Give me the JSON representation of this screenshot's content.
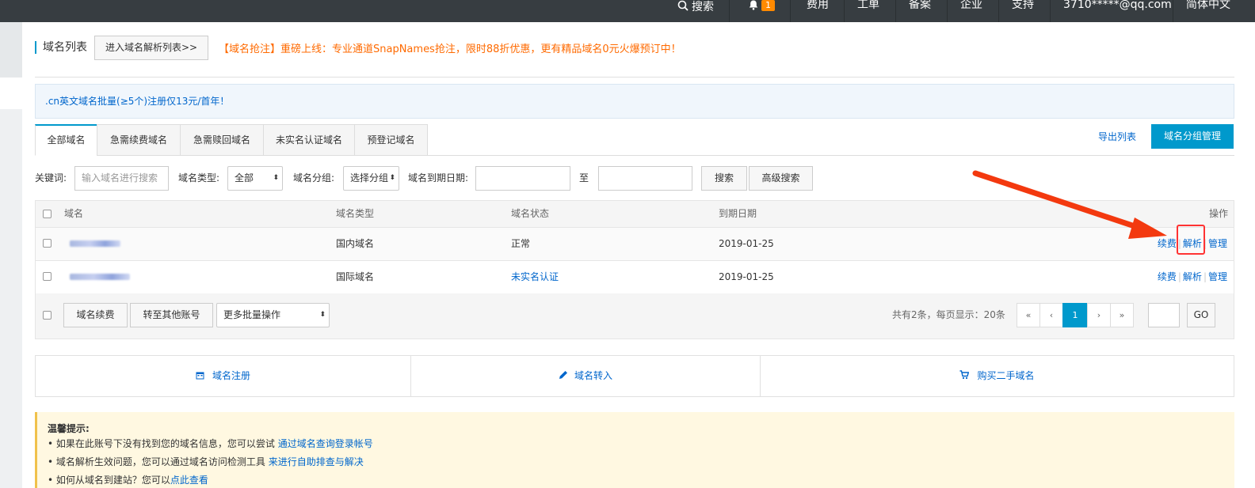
{
  "topbar": {
    "search": "搜索",
    "notice_count": "1",
    "fees": "费用",
    "tickets": "工单",
    "icp": "备案",
    "enterprise": "企业",
    "support": "支持",
    "account": "3710*****@qq.com",
    "language": "简体中文"
  },
  "header": {
    "title": "域名列表",
    "dns_list_button": "进入域名解析列表>>",
    "promo": "【域名抢注】重磅上线：专业通道SnapNames抢注，限时88折优惠，更有精品域名0元火爆预订中！"
  },
  "notice": ".cn英文域名批量(≥5个)注册仅13元/首年！",
  "tabs": [
    "全部域名",
    "急需续费域名",
    "急需赎回域名",
    "未实名认证域名",
    "预登记域名"
  ],
  "actions": {
    "export": "导出列表",
    "group_manage": "域名分组管理"
  },
  "filters": {
    "keyword_label": "关键词:",
    "keyword_placeholder": "输入域名进行搜索",
    "type_label": "域名类型:",
    "type_value": "全部",
    "group_label": "域名分组:",
    "group_value": "选择分组",
    "expire_label": "域名到期日期:",
    "to": "至",
    "search": "搜索",
    "advanced": "高级搜索"
  },
  "table": {
    "headers": {
      "domain": "域名",
      "type": "域名类型",
      "status": "域名状态",
      "expire": "到期日期",
      "ops": "操作"
    },
    "rows": [
      {
        "type": "国内域名",
        "status": "正常",
        "expire": "2019-01-25",
        "renew": "续费",
        "resolve": "解析",
        "manage": "管理"
      },
      {
        "type": "国际域名",
        "status": "未实名认证",
        "expire": "2019-01-25",
        "renew": "续费",
        "resolve": "解析",
        "manage": "管理"
      }
    ]
  },
  "bulk": {
    "renew": "域名续费",
    "transfer": "转至其他账号",
    "more": "更多批量操作",
    "summary": "共有2条，每页显示：20条",
    "first": "«",
    "prev": "‹",
    "page": "1",
    "next": "›",
    "last": "»",
    "go": "GO"
  },
  "quick": {
    "register": "域名注册",
    "transfer_in": "域名转入",
    "buy": "购买二手域名"
  },
  "tips": {
    "title": "温馨提示:",
    "line1_text": "• 如果在此账号下没有找到您的域名信息，您可以尝试 ",
    "line1_link": "通过域名查询登录帐号",
    "line2_text": "• 域名解析生效问题，您可以通过域名访问检测工具 ",
    "line2_link": "来进行自助排查与解决",
    "line3_text": "• 如何从域名到建站？您可以",
    "line3_link": "点此查看"
  },
  "colors": {
    "accent": "#0099cc",
    "link": "#0066cc",
    "promo": "#ff6a00",
    "annotation": "#ff3300"
  }
}
